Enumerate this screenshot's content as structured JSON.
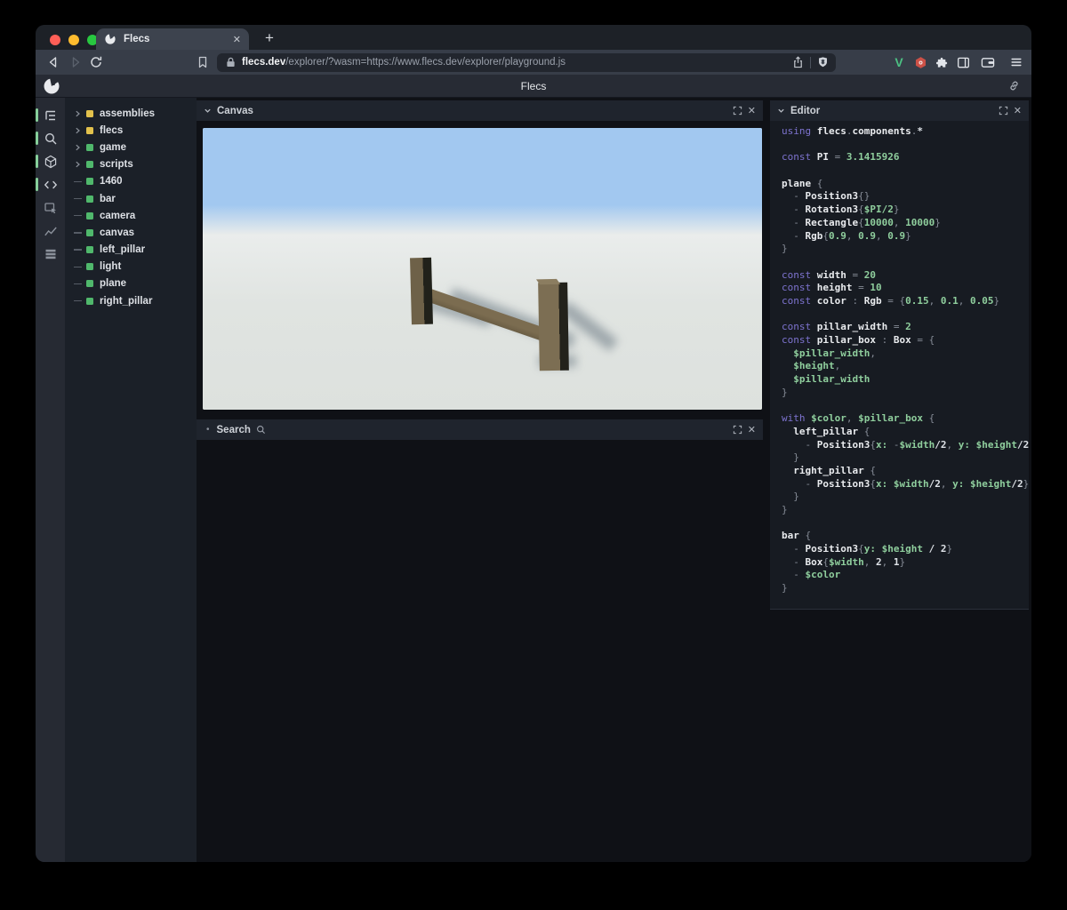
{
  "browser": {
    "tab_title": "Flecs",
    "url_domain": "flecs.dev",
    "url_path": "/explorer/?wasm=https://www.flecs.dev/explorer/playground.js"
  },
  "icons": {
    "new_tab": "+",
    "tab_close": "✕",
    "panel_close": "✕",
    "bullet": "•",
    "v_extension": "V"
  },
  "header": {
    "title": "Flecs"
  },
  "sidebar": {
    "tools": [
      {
        "icon": "tree-icon",
        "active": true
      },
      {
        "icon": "search-icon",
        "active": true
      },
      {
        "icon": "cube-icon",
        "active": true
      },
      {
        "icon": "code-icon",
        "active": true
      },
      {
        "icon": "select-icon",
        "active": false
      },
      {
        "icon": "chart-icon",
        "active": false
      },
      {
        "icon": "rows-icon",
        "active": false
      }
    ],
    "tree": [
      {
        "label": "assemblies",
        "color": "#e2c14c",
        "has_children": true
      },
      {
        "label": "flecs",
        "color": "#e2c14c",
        "has_children": true
      },
      {
        "label": "game",
        "color": "#50b86c",
        "has_children": true
      },
      {
        "label": "scripts",
        "color": "#50b86c",
        "has_children": true
      },
      {
        "label": "1460",
        "color": "#50b86c",
        "has_children": false
      },
      {
        "label": "bar",
        "color": "#50b86c",
        "has_children": false
      },
      {
        "label": "camera",
        "color": "#50b86c",
        "has_children": false
      },
      {
        "label": "canvas",
        "color": "#50b86c",
        "has_children": false
      },
      {
        "label": "left_pillar",
        "color": "#50b86c",
        "has_children": false
      },
      {
        "label": "light",
        "color": "#50b86c",
        "has_children": false
      },
      {
        "label": "plane",
        "color": "#50b86c",
        "has_children": false
      },
      {
        "label": "right_pillar",
        "color": "#50b86c",
        "has_children": false
      }
    ]
  },
  "panels": {
    "canvas": {
      "title": "Canvas"
    },
    "search": {
      "title": "Search"
    },
    "editor": {
      "title": "Editor"
    }
  },
  "editor_code": {
    "lines": [
      [
        [
          "k",
          "using "
        ],
        [
          "i",
          "flecs"
        ],
        [
          "p",
          "."
        ],
        [
          "i",
          "components"
        ],
        [
          "p",
          "."
        ],
        [
          "w",
          "*"
        ]
      ],
      [],
      [
        [
          "k",
          "const "
        ],
        [
          "i",
          "PI"
        ],
        [
          "p",
          " = "
        ],
        [
          "n",
          "3.1415926"
        ]
      ],
      [],
      [
        [
          "i",
          "plane"
        ],
        [
          "p",
          " {"
        ]
      ],
      [
        [
          "p",
          "  - "
        ],
        [
          "i",
          "Position3"
        ],
        [
          "p",
          "{}"
        ]
      ],
      [
        [
          "p",
          "  - "
        ],
        [
          "i",
          "Rotation3"
        ],
        [
          "p",
          "{"
        ],
        [
          "n",
          "$PI/2"
        ],
        [
          "p",
          "}"
        ]
      ],
      [
        [
          "p",
          "  - "
        ],
        [
          "i",
          "Rectangle"
        ],
        [
          "p",
          "{"
        ],
        [
          "n",
          "10000"
        ],
        [
          "p",
          ", "
        ],
        [
          "n",
          "10000"
        ],
        [
          "p",
          "}"
        ]
      ],
      [
        [
          "p",
          "  - "
        ],
        [
          "i",
          "Rgb"
        ],
        [
          "p",
          "{"
        ],
        [
          "n",
          "0.9"
        ],
        [
          "p",
          ", "
        ],
        [
          "n",
          "0.9"
        ],
        [
          "p",
          ", "
        ],
        [
          "n",
          "0.9"
        ],
        [
          "p",
          "}"
        ]
      ],
      [
        [
          "p",
          "}"
        ]
      ],
      [],
      [
        [
          "k",
          "const "
        ],
        [
          "i",
          "width"
        ],
        [
          "p",
          " = "
        ],
        [
          "n",
          "20"
        ]
      ],
      [
        [
          "k",
          "const "
        ],
        [
          "i",
          "height"
        ],
        [
          "p",
          " = "
        ],
        [
          "n",
          "10"
        ]
      ],
      [
        [
          "k",
          "const "
        ],
        [
          "i",
          "color"
        ],
        [
          "p",
          " : "
        ],
        [
          "i",
          "Rgb"
        ],
        [
          "p",
          " = {"
        ],
        [
          "n",
          "0.15"
        ],
        [
          "p",
          ", "
        ],
        [
          "n",
          "0.1"
        ],
        [
          "p",
          ", "
        ],
        [
          "n",
          "0.05"
        ],
        [
          "p",
          "}"
        ]
      ],
      [],
      [
        [
          "k",
          "const "
        ],
        [
          "i",
          "pillar_width"
        ],
        [
          "p",
          " = "
        ],
        [
          "n",
          "2"
        ]
      ],
      [
        [
          "k",
          "const "
        ],
        [
          "i",
          "pillar_box"
        ],
        [
          "p",
          " : "
        ],
        [
          "i",
          "Box"
        ],
        [
          "p",
          " = {"
        ]
      ],
      [
        [
          "n",
          "  $pillar_width"
        ],
        [
          "p",
          ","
        ]
      ],
      [
        [
          "n",
          "  $height"
        ],
        [
          "p",
          ","
        ]
      ],
      [
        [
          "n",
          "  $pillar_width"
        ]
      ],
      [
        [
          "p",
          "}"
        ]
      ],
      [],
      [
        [
          "k",
          "with "
        ],
        [
          "n",
          "$color"
        ],
        [
          "p",
          ", "
        ],
        [
          "n",
          "$pillar_box"
        ],
        [
          "p",
          " {"
        ]
      ],
      [
        [
          "i",
          "  left_pillar"
        ],
        [
          "p",
          " {"
        ]
      ],
      [
        [
          "p",
          "    - "
        ],
        [
          "i",
          "Position3"
        ],
        [
          "p",
          "{"
        ],
        [
          "n",
          "x: "
        ],
        [
          "p",
          "-"
        ],
        [
          "n",
          "$width"
        ],
        [
          "w",
          "/2"
        ],
        [
          "p",
          ", "
        ],
        [
          "n",
          "y: $height"
        ],
        [
          "w",
          "/2"
        ],
        [
          "p",
          "}"
        ]
      ],
      [
        [
          "p",
          "  }"
        ]
      ],
      [
        [
          "i",
          "  right_pillar"
        ],
        [
          "p",
          " {"
        ]
      ],
      [
        [
          "p",
          "    - "
        ],
        [
          "i",
          "Position3"
        ],
        [
          "p",
          "{"
        ],
        [
          "n",
          "x: $width"
        ],
        [
          "w",
          "/2"
        ],
        [
          "p",
          ", "
        ],
        [
          "n",
          "y: $height"
        ],
        [
          "w",
          "/2"
        ],
        [
          "p",
          "}"
        ]
      ],
      [
        [
          "p",
          "  }"
        ]
      ],
      [
        [
          "p",
          "}"
        ]
      ],
      [],
      [
        [
          "i",
          "bar"
        ],
        [
          "p",
          " {"
        ]
      ],
      [
        [
          "p",
          "  - "
        ],
        [
          "i",
          "Position3"
        ],
        [
          "p",
          "{"
        ],
        [
          "n",
          "y: $height"
        ],
        [
          "w",
          " / 2"
        ],
        [
          "p",
          "}"
        ]
      ],
      [
        [
          "p",
          "  - "
        ],
        [
          "i",
          "Box"
        ],
        [
          "p",
          "{"
        ],
        [
          "n",
          "$width"
        ],
        [
          "p",
          ", "
        ],
        [
          "w",
          "2"
        ],
        [
          "p",
          ", "
        ],
        [
          "w",
          "1"
        ],
        [
          "p",
          "}"
        ]
      ],
      [
        [
          "p",
          "  - "
        ],
        [
          "n",
          "$color"
        ]
      ],
      [
        [
          "p",
          "}"
        ]
      ]
    ]
  },
  "colors": {
    "traffic_close": "#ff5f57",
    "traffic_min": "#febc2e",
    "traffic_zoom": "#28c840",
    "keyword": "#7d73cf",
    "value_green": "#8fce9d",
    "sky": "#a2c8f0",
    "ground": "#e0e4e1",
    "wood": "#73664b",
    "entity_yellow": "#e2c14c",
    "entity_green": "#50b86c",
    "tool_active": "#86cf9a"
  }
}
